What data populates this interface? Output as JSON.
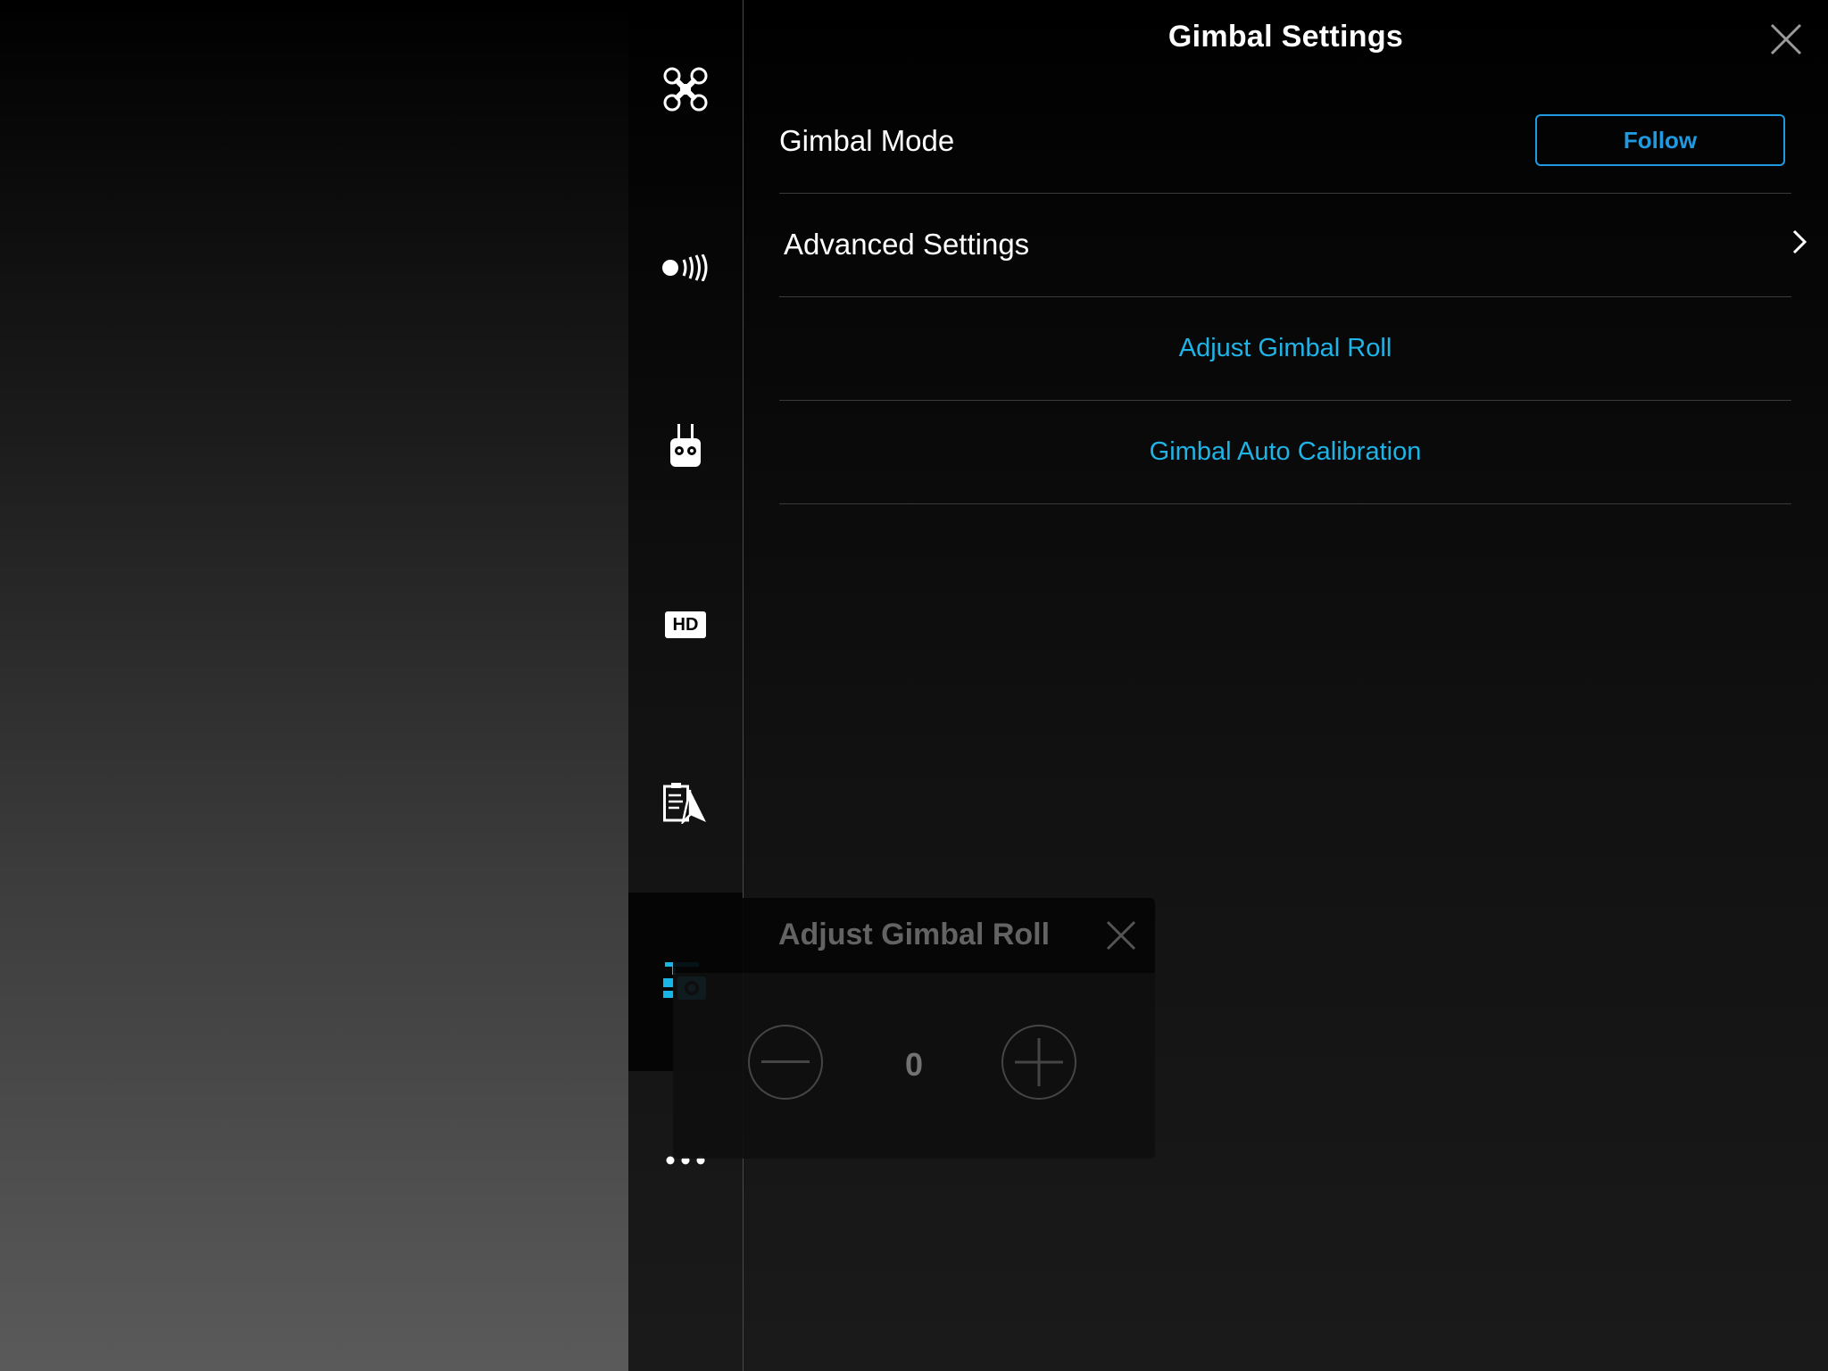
{
  "panel": {
    "title": "Gimbal Settings",
    "gimbal_mode": {
      "label": "Gimbal Mode",
      "value": "Follow"
    },
    "advanced": {
      "label": "Advanced Settings"
    },
    "adjust_roll_link": "Adjust Gimbal Roll",
    "auto_calibration_link": "Gimbal Auto Calibration"
  },
  "sidebar": {
    "items": [
      {
        "icon": "aircraft-icon"
      },
      {
        "icon": "signal-strength-icon"
      },
      {
        "icon": "remote-controller-icon"
      },
      {
        "icon": "hd-icon",
        "text": "HD"
      },
      {
        "icon": "safety-checklist-icon"
      },
      {
        "icon": "gimbal-camera-icon",
        "active": true
      },
      {
        "icon": "more-icon"
      }
    ]
  },
  "roll_dialog": {
    "title": "Adjust Gimbal Roll",
    "value": "0"
  },
  "colors": {
    "accent": "#1fb3e6",
    "button_border": "#1f9ae0",
    "active_icon": "#19b5e6"
  }
}
